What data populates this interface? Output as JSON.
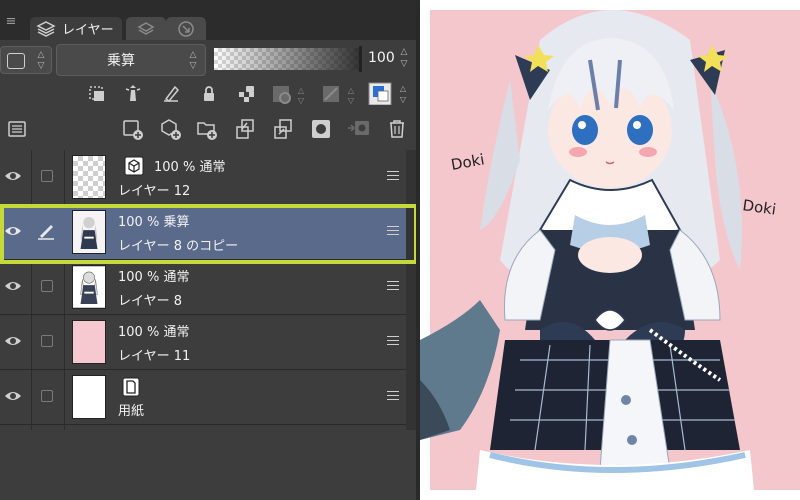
{
  "tabs": {
    "active_label": "レイヤー"
  },
  "blend": {
    "mode": "乗算"
  },
  "opacity": {
    "value": "100",
    "level": 1.0
  },
  "layers": [
    {
      "percent": "100 %",
      "mode": "通常",
      "name": "レイヤー 12",
      "kind": "3d",
      "thumb": "transparent",
      "selected": false
    },
    {
      "percent": "100 %",
      "mode": "乗算",
      "name": "レイヤー 8 のコピー",
      "kind": "raster",
      "thumb": "art",
      "selected": true
    },
    {
      "percent": "100 %",
      "mode": "通常",
      "name": "レイヤー 8",
      "kind": "raster",
      "thumb": "art",
      "selected": false
    },
    {
      "percent": "100 %",
      "mode": "通常",
      "name": "レイヤー 11",
      "kind": "raster",
      "thumb": "pink",
      "selected": false
    },
    {
      "name": "用紙",
      "kind": "paper",
      "thumb": "white",
      "selected": false
    }
  ],
  "canvas": {
    "text_left": "Doki",
    "text_right": "Doki"
  },
  "colors": {
    "accent_highlight": "#c5d93a",
    "selected_row": "#5a6a8a",
    "canvas_bg": "#f4c7cc",
    "layer_color_swatch": "#2a6fd6"
  }
}
